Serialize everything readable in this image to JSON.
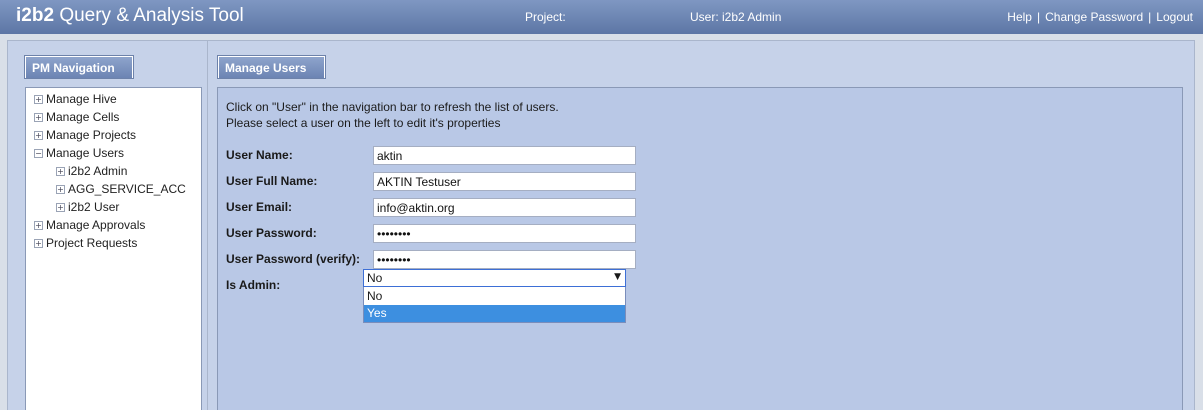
{
  "header": {
    "brand": "i2b2",
    "title_rest": "Query & Analysis Tool",
    "project_label": "Project:",
    "user_label": "User: i2b2 Admin",
    "links": [
      "Help",
      "Change Password",
      "Logout"
    ],
    "separator": "|"
  },
  "left_tab": {
    "label": "PM Navigation"
  },
  "nav_tree": [
    {
      "label": "Manage Hive",
      "toggle": "+"
    },
    {
      "label": "Manage Cells",
      "toggle": "+"
    },
    {
      "label": "Manage Projects",
      "toggle": "+"
    },
    {
      "label": "Manage Users",
      "toggle": "−"
    },
    {
      "label": "i2b2 Admin",
      "toggle": "+"
    },
    {
      "label": "AGG_SERVICE_ACC",
      "toggle": "+"
    },
    {
      "label": "i2b2 User",
      "toggle": "+"
    },
    {
      "label": "Manage Approvals",
      "toggle": "+"
    },
    {
      "label": "Project Requests",
      "toggle": "+"
    }
  ],
  "right_tab": {
    "label": "Manage Users"
  },
  "messages": {
    "line1": "Click on \"User\" in the navigation bar to refresh the list of users.",
    "line2": "Please select a user on the left to edit it's properties"
  },
  "form": {
    "user_name": {
      "label": "User Name:",
      "value": "aktin"
    },
    "full_name": {
      "label": "User Full Name:",
      "value": "AKTIN Testuser"
    },
    "email": {
      "label": "User Email:",
      "value": "info@aktin.org"
    },
    "password": {
      "label": "User Password:",
      "value": "password"
    },
    "password_verify": {
      "label": "User Password (verify):",
      "value": "password"
    },
    "is_admin": {
      "label": "Is Admin:",
      "selected": "No",
      "options": [
        "No",
        "Yes"
      ],
      "highlighted": "Yes"
    }
  },
  "colors": {
    "header": "#6a82b0",
    "panel_bg": "#b9c8e6",
    "highlight": "#3d8fe0"
  }
}
